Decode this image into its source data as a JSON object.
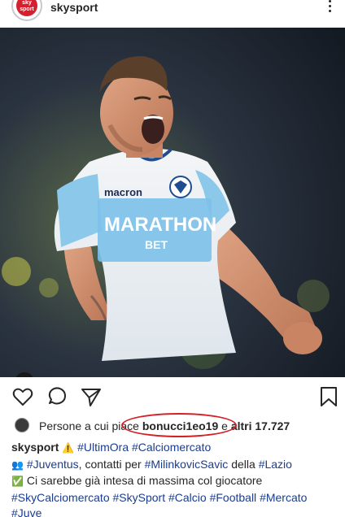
{
  "header": {
    "username": "skysport",
    "avatar_text": "sky sport"
  },
  "post": {
    "photo_subject": "Lazio player celebrating in light-blue MARATHON BET jersey",
    "jersey_brand": "macron",
    "jersey_sponsor_line1": "MARATHON",
    "jersey_sponsor_line2": "BET"
  },
  "likes": {
    "prefix": "Persone a cui piace",
    "user": "bonucci1eo19",
    "middle": "e",
    "others": "altri 17.727"
  },
  "caption": {
    "user": "skysport",
    "line1_emoji": "⚠️",
    "line1_tags": [
      "#UltimOra",
      "#Calciomercato"
    ],
    "line2_emoji": "👥",
    "line2_tag1": "#Juventus",
    "line2_text1": ", contatti per",
    "line2_tag2": "#MilinkovicSavic",
    "line2_text2": "della",
    "line2_tag3": "#Lazio",
    "line3_emoji": "✅",
    "line3_text": "Ci sarebbe già intesa di massima col giocatore",
    "line4_tags": [
      "#SkyCalciomercato",
      "#SkySport",
      "#Calcio",
      "#Football",
      "#Mercato"
    ],
    "line5_tags": [
      "#Juve"
    ]
  },
  "colors": {
    "accent_tag": "#1a3d8f",
    "annotation_circle": "#d31f25",
    "sky_red": "#d5202e"
  }
}
